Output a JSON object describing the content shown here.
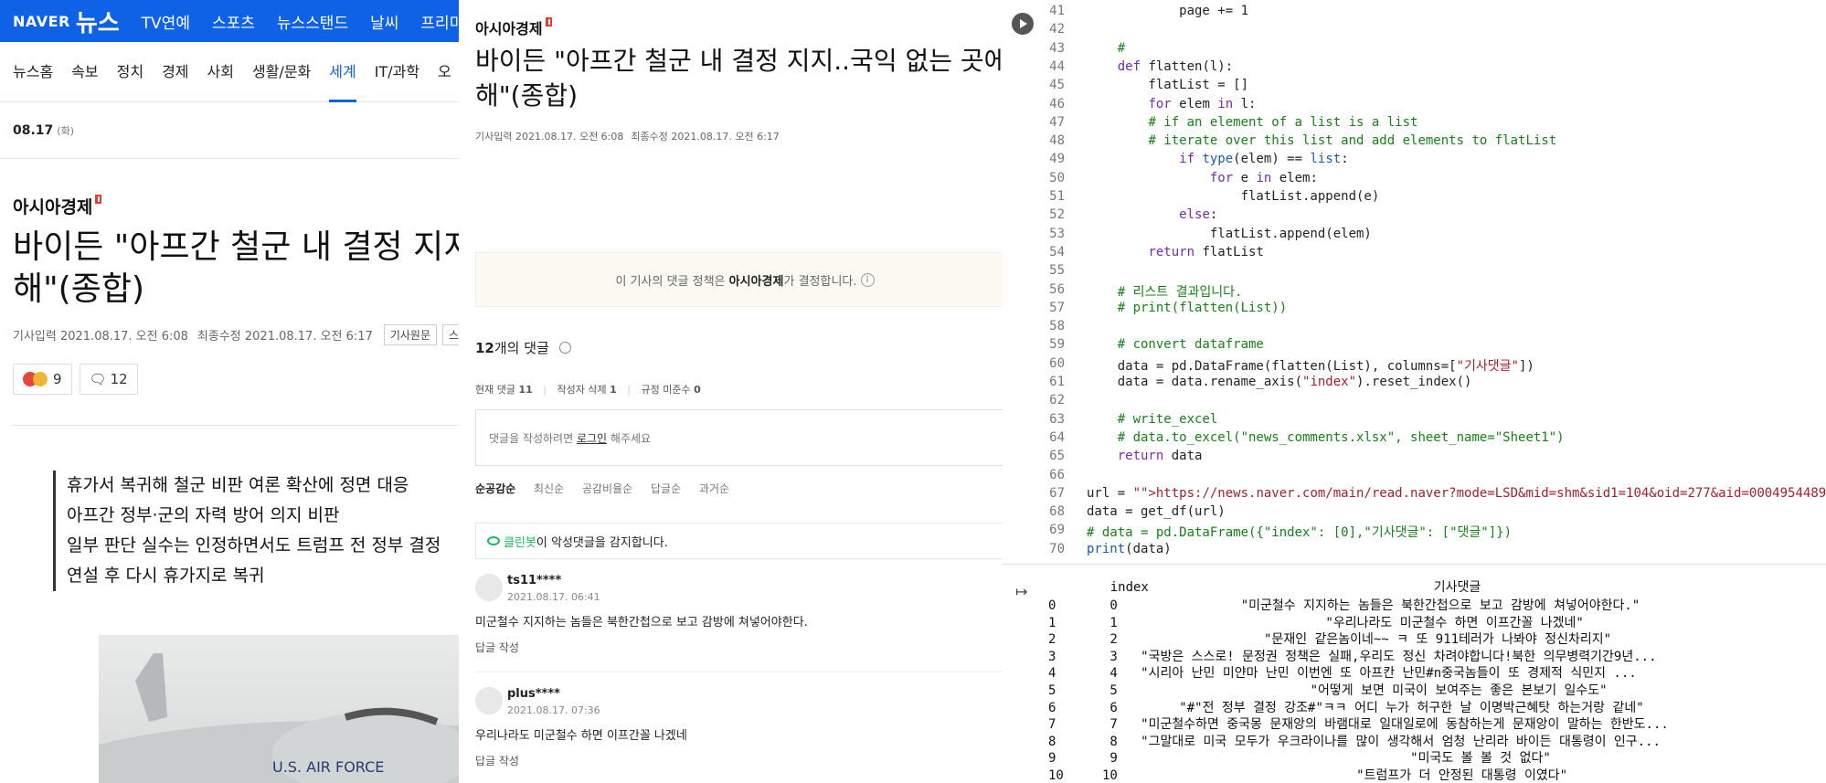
{
  "p1": {
    "brand": "NAVER",
    "news": "뉴스",
    "nav": [
      "TV연예",
      "스포츠",
      "뉴스스탠드",
      "날씨",
      "프리미엄"
    ],
    "subnav": [
      "뉴스홈",
      "속보",
      "정치",
      "경제",
      "사회",
      "생활/문화",
      "세계",
      "IT/과학",
      "오"
    ],
    "active_subnav": "세계",
    "date": "08.17",
    "weekday": "(화)",
    "press": "아시아경제",
    "headline_line1": "바이든 \"아프간 철군 내 결정 지지..국",
    "headline_line2": "해\"(종합)",
    "meta_published": "기사입력 2021.08.17. 오전 6:08",
    "meta_modified": "최종수정 2021.08.17. 오전 6:17",
    "tag_original": "기사원문",
    "tag_scrap": "스크랩",
    "reaction_count": "9",
    "comment_count": "12",
    "summary": [
      "휴가서 복귀해 철군 비판 여론 확산에 정면 대응",
      "아프간 정부·군의 자력 방어 의지 비판",
      "일부 판단 실수는 인정하면서도 트럼프 전 정부 결정",
      "연설 후 다시 휴가지로 복귀"
    ],
    "image_text": "U.S. AIR FORCE"
  },
  "p2": {
    "press": "아시아경제",
    "headline_line1": "바이든 \"아프간 철군 내 결정 지지..국익 없는 곳에",
    "headline_line2": "해\"(종합)",
    "meta_published": "기사입력 2021.08.17. 오전 6:08",
    "meta_modified": "최종수정 2021.08.17. 오전 6:17",
    "policy_pre": "이 기사의 댓글 정책은",
    "policy_press": "아시아경제",
    "policy_post": "가 결정합니다.",
    "comments_count": "12",
    "comments_label": "개의 댓글",
    "stat_current_label": "현재 댓글",
    "stat_current": "11",
    "stat_author_label": "작성자 삭제",
    "stat_author": "1",
    "stat_rule_label": "규정 미준수",
    "stat_rule": "0",
    "input_pre": "댓글을 작성하려면",
    "input_login": "로그인",
    "input_post": "해주세요",
    "sort": [
      "순공감순",
      "최신순",
      "공감비율순",
      "답글순",
      "과거순"
    ],
    "cleanbot_name": "클린봇",
    "cleanbot_text": "이 악성댓글을 감지합니다.",
    "comments": [
      {
        "user": "ts11****",
        "date": "2021.08.17. 06:41",
        "body": "미군철수 지지하는 놈들은 북한간첩으로 보고 감방에 쳐넣어야한다.",
        "reply": "답글 작성"
      },
      {
        "user": "plus****",
        "date": "2021.08.17. 07:36",
        "body": "우리나라도 미군철수 하면 이프간꼴 나겠네",
        "reply": "답글 작성"
      }
    ]
  },
  "code": {
    "lines": [
      {
        "n": "41",
        "t": "            page += 1"
      },
      {
        "n": "42",
        "t": ""
      },
      {
        "n": "43",
        "t": "    #"
      },
      {
        "n": "44",
        "t": "    def flatten(l):"
      },
      {
        "n": "45",
        "t": "        flatList = []"
      },
      {
        "n": "46",
        "t": "        for elem in l:"
      },
      {
        "n": "47",
        "t": "        # if an element of a list is a list"
      },
      {
        "n": "48",
        "t": "        # iterate over this list and add elements to flatList"
      },
      {
        "n": "49",
        "t": "            if type(elem) == list:"
      },
      {
        "n": "50",
        "t": "                for e in elem:"
      },
      {
        "n": "51",
        "t": "                    flatList.append(e)"
      },
      {
        "n": "52",
        "t": "            else:"
      },
      {
        "n": "53",
        "t": "                flatList.append(elem)"
      },
      {
        "n": "54",
        "t": "        return flatList"
      },
      {
        "n": "55",
        "t": ""
      },
      {
        "n": "56",
        "t": "    # 리스트 결과입니다."
      },
      {
        "n": "57",
        "t": "    # print(flatten(List))"
      },
      {
        "n": "58",
        "t": ""
      },
      {
        "n": "59",
        "t": "    # convert dataframe"
      },
      {
        "n": "60",
        "t": "    data = pd.DataFrame(flatten(List), columns=[\"기사댓글\"])"
      },
      {
        "n": "61",
        "t": "    data = data.rename_axis(\"index\").reset_index()"
      },
      {
        "n": "62",
        "t": ""
      },
      {
        "n": "63",
        "t": "    # write_excel"
      },
      {
        "n": "64",
        "t": "    # data.to_excel(\"news_comments.xlsx\", sheet_name=\"Sheet1\")"
      },
      {
        "n": "65",
        "t": "    return data"
      },
      {
        "n": "66",
        "t": ""
      },
      {
        "n": "67",
        "t": "url = \"https://news.naver.com/main/read.naver?mode=LSD&mid=shm&sid1=104&oid=277&aid=0004954489\""
      },
      {
        "n": "68",
        "t": "data = get_df(url)"
      },
      {
        "n": "69",
        "t": "# data = pd.DataFrame({\"index\": [0],\"기사댓글\": [\"댓글\"]})"
      },
      {
        "n": "70",
        "t": "print(data)"
      }
    ]
  },
  "output": {
    "header": "    index                                     기사댓글",
    "rows": [
      "0       0                \"미군철수 지지하는 놈들은 북한간첩으로 보고 감방에 쳐넣어야한다.\"",
      "1       1                           \"우리나라도 미군철수 하면 이프간꼴 나겠네\"",
      "2       2                   \"문재인 같은놈이네~~ ㅋ 또 911테러가 나봐야 정신차리지\"",
      "3       3   \"국방은 스스로! 문정권 정책은 실패,우리도 정신 차려야합니다!북한 의무병력기간9년...",
      "4       4   \"시리아 난민 미얀마 난민 이번엔 또 아프칸 난민#n중국놈들이 또 경제적 식민지 ...",
      "5       5                         \"어떻게 보면 미국이 보여주는 좋은 본보기 일수도\"",
      "6       6        \"#\"전 정부 결정 강조#\"ㅋㅋ 어디 누가 허구한 날 이명박근혜탓 하는거랑 같네\"",
      "7       7   \"미군철수하면 중국몽 문재앙의 바램대로 일대일로에 동참하는게 문재앙이 말하는 한반도...",
      "8       8   \"그말대로 미국 모두가 우크라이나를 많이 생각해서 엄청 난리라 바이든 대통령이 인구...",
      "9       9                                      \"미국도 볼 볼 것 없다\"",
      "10     10                               \"트럼프가 더 안정된 대통령 이였다\""
    ]
  }
}
